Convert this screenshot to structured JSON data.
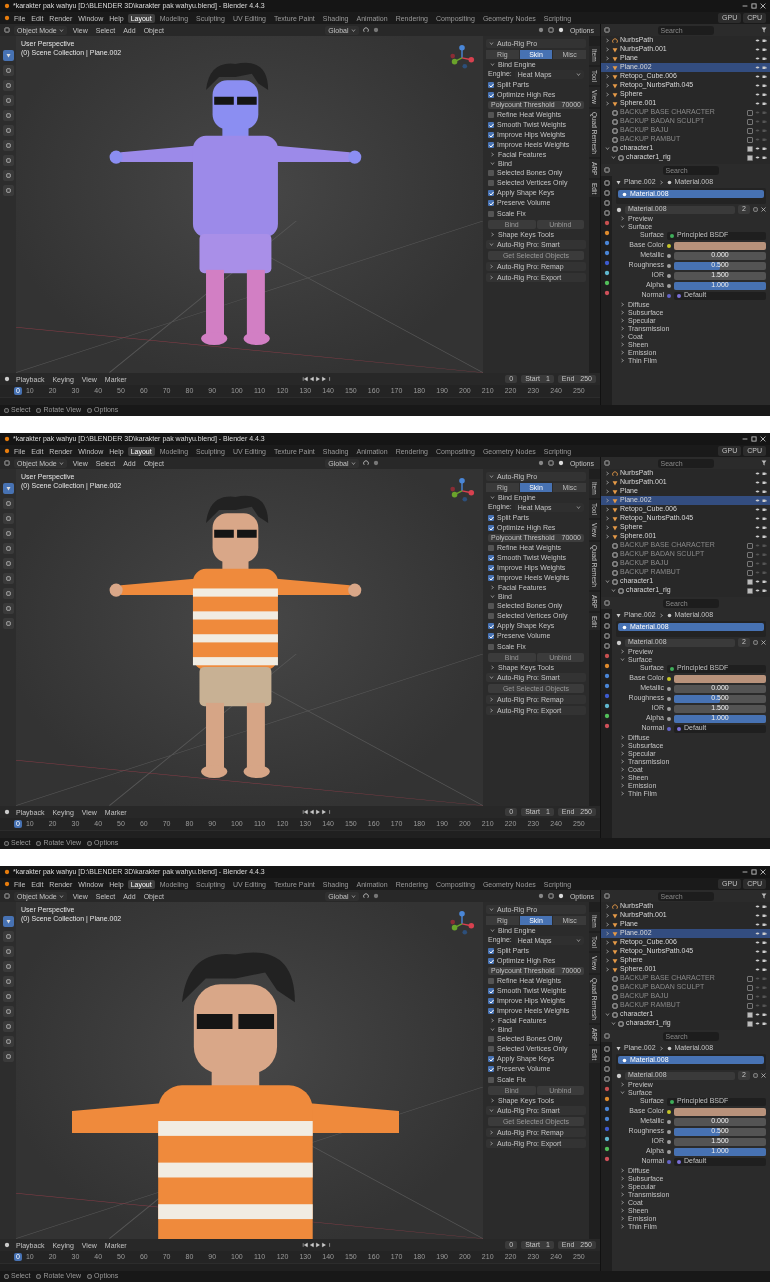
{
  "screens": [
    {
      "title": "*karakter pak wahyu [D:\\BLENDER 3D\\karakter pak wahyu.blend] - Blender 4.4.3",
      "menus": [
        "File",
        "Edit",
        "Render",
        "Window",
        "Help"
      ],
      "workspaces": [
        {
          "label": "Layout",
          "selected": true
        },
        {
          "label": "Modeling",
          "selected": false
        },
        {
          "label": "Sculpting",
          "selected": false
        },
        {
          "label": "UV Editing",
          "selected": false
        },
        {
          "label": "Texture Paint",
          "selected": false
        },
        {
          "label": "Shading",
          "selected": false
        },
        {
          "label": "Animation",
          "selected": false
        },
        {
          "label": "Rendering",
          "selected": false
        },
        {
          "label": "Compositing",
          "selected": false
        },
        {
          "label": "Geometry Nodes",
          "selected": false
        },
        {
          "label": "Scripting",
          "selected": false
        }
      ],
      "stats": [
        "GPU",
        "CPU"
      ],
      "header": {
        "mode": "Object Mode",
        "menus": [
          "View",
          "Select",
          "Add",
          "Object"
        ],
        "orientation": "Global",
        "options": "Options"
      },
      "viewport": {
        "kind": "normals",
        "lines": [
          "User Perspective",
          "(0) Scene Collection | Plane.002"
        ]
      },
      "arp": {
        "title": "Auto-Rig Pro",
        "tabs": [
          {
            "label": "Rig",
            "selected": false
          },
          {
            "label": "Skin",
            "selected": true
          },
          {
            "label": "Misc",
            "selected": false
          }
        ],
        "items": [
          {
            "kind": "section",
            "label": "Bind Engine",
            "expanded": true
          },
          {
            "kind": "select",
            "label": "Engine:",
            "value": "Heat Maps"
          },
          {
            "kind": "check",
            "label": "Split Parts",
            "checked": true
          },
          {
            "kind": "check",
            "label": "Optimize High Res",
            "checked": true
          },
          {
            "kind": "number",
            "label": "Polycount Threshold",
            "value": "70000"
          },
          {
            "kind": "check",
            "label": "Refine Heat Weights",
            "checked": false
          },
          {
            "kind": "check",
            "label": "Smooth Twist Weights",
            "checked": true
          },
          {
            "kind": "check",
            "label": "Improve Hips Weights",
            "checked": true
          },
          {
            "kind": "check",
            "label": "Improve Heels Weights",
            "checked": true
          },
          {
            "kind": "section",
            "label": "Facial Features",
            "expanded": false
          },
          {
            "kind": "section",
            "label": "Bind",
            "expanded": true
          },
          {
            "kind": "check",
            "label": "Selected Bones Only",
            "checked": false
          },
          {
            "kind": "check",
            "label": "Selected Vertices Only",
            "checked": false
          },
          {
            "kind": "check",
            "label": "Apply Shape Keys",
            "checked": true
          },
          {
            "kind": "check",
            "label": "Preserve Volume",
            "checked": true
          },
          {
            "kind": "check",
            "label": "Scale Fix",
            "checked": false
          },
          {
            "kind": "buttons",
            "labels": [
              "Bind",
              "Unbind"
            ]
          },
          {
            "kind": "section",
            "label": "Shape Keys Tools",
            "expanded": false
          },
          {
            "kind": "panel",
            "label": "Auto-Rig Pro: Smart",
            "expanded": true
          },
          {
            "kind": "button",
            "label": "Get Selected Objects"
          },
          {
            "kind": "panel",
            "label": "Auto-Rig Pro: Remap",
            "expanded": false
          },
          {
            "kind": "panel",
            "label": "Auto-Rig Pro: Export",
            "expanded": false
          }
        ]
      },
      "side_tabs": [
        "Item",
        "Tool",
        "View",
        "Quad Remesh",
        "ARP",
        "Edit"
      ],
      "outliner": {
        "placeholder": "Search",
        "items": [
          {
            "kind": "curve",
            "label": "NurbsPath",
            "selected": false,
            "expanded": false
          },
          {
            "kind": "mesh",
            "label": "NurbsPath.001",
            "selected": false,
            "expanded": false
          },
          {
            "kind": "mesh",
            "label": "Plane",
            "selected": false,
            "expanded": false
          },
          {
            "kind": "mesh",
            "label": "Plane.002",
            "selected": true,
            "expanded": false
          },
          {
            "kind": "mesh",
            "label": "Retopo_Cube.006",
            "selected": false,
            "expanded": false
          },
          {
            "kind": "mesh",
            "label": "Retopo_NurbsPath.045",
            "selected": false,
            "expanded": false
          },
          {
            "kind": "mesh",
            "label": "Sphere",
            "selected": false,
            "expanded": false
          },
          {
            "kind": "mesh",
            "label": "Sphere.001",
            "selected": false,
            "expanded": false
          },
          {
            "kind": "collection",
            "label": "BACKUP BASE CHARACTER",
            "selected": false,
            "included": false
          },
          {
            "kind": "collection",
            "label": "BACKUP BADAN SCULPT",
            "selected": false,
            "included": false
          },
          {
            "kind": "collection",
            "label": "BACKUP BAJU",
            "selected": false,
            "included": false
          },
          {
            "kind": "collection",
            "label": "BACKUP RAMBUT",
            "selected": false,
            "included": false
          },
          {
            "kind": "collection",
            "label": "character1",
            "selected": false,
            "included": true,
            "expanded": true,
            "children": [
              {
                "kind": "collection",
                "label": "character1_rig",
                "selected": false,
                "included": true,
                "expanded": true
              }
            ]
          }
        ]
      },
      "properties": {
        "placeholder": "Search",
        "breadcrumb": [
          "Plane.002",
          "Material.008"
        ],
        "slot": "Material.008",
        "material": "Material.008",
        "users": "2",
        "sections": [
          {
            "label": "Preview",
            "expanded": false
          },
          {
            "label": "Surface",
            "expanded": true
          }
        ],
        "surface_label": "Surface",
        "surface": "Principled BSDF",
        "inputs": [
          {
            "kind": "color",
            "label": "Base Color",
            "color": "#b8927b"
          },
          {
            "kind": "slider",
            "label": "Metallic",
            "value": "0.000",
            "level": 0
          },
          {
            "kind": "slider",
            "label": "Roughness",
            "value": "0.500",
            "level": 0.5
          },
          {
            "kind": "slider",
            "label": "IOR",
            "value": "1.500",
            "level": 0
          },
          {
            "kind": "slider",
            "label": "Alpha",
            "value": "1.000",
            "level": 1
          },
          {
            "kind": "link",
            "label": "Normal",
            "value": "Default"
          }
        ],
        "subsections": [
          {
            "label": "Diffuse",
            "expanded": false
          },
          {
            "label": "Subsurface",
            "expanded": false
          },
          {
            "label": "Specular",
            "expanded": false
          },
          {
            "label": "Transmission",
            "expanded": false
          },
          {
            "label": "Coat",
            "expanded": false
          },
          {
            "label": "Sheen",
            "expanded": false
          },
          {
            "label": "Emission",
            "expanded": false
          },
          {
            "label": "Thin Film",
            "expanded": false
          }
        ]
      },
      "timeline": {
        "menus": [
          "Playback",
          "Keying",
          "View",
          "Marker"
        ],
        "frame": "0",
        "start_label": "Start",
        "start": "1",
        "end_label": "End",
        "end": "250",
        "playhead": "0",
        "ticks": [
          "10",
          "20",
          "30",
          "40",
          "50",
          "60",
          "70",
          "80",
          "90",
          "100",
          "110",
          "120",
          "130",
          "140",
          "150",
          "160",
          "170",
          "180",
          "190",
          "200",
          "210",
          "220",
          "230",
          "240",
          "250"
        ]
      },
      "status": [
        "Select",
        "Rotate View",
        "Options"
      ]
    },
    {
      "title": "*karakter pak wahyu [D:\\BLENDER 3D\\karakter pak wahyu.blend] - Blender 4.4.3",
      "menus": [
        "File",
        "Edit",
        "Render",
        "Window",
        "Help"
      ],
      "workspaces": [
        {
          "label": "Layout",
          "selected": true
        },
        {
          "label": "Modeling",
          "selected": false
        },
        {
          "label": "Sculpting",
          "selected": false
        },
        {
          "label": "UV Editing",
          "selected": false
        },
        {
          "label": "Texture Paint",
          "selected": false
        },
        {
          "label": "Shading",
          "selected": false
        },
        {
          "label": "Animation",
          "selected": false
        },
        {
          "label": "Rendering",
          "selected": false
        },
        {
          "label": "Compositing",
          "selected": false
        },
        {
          "label": "Geometry Nodes",
          "selected": false
        },
        {
          "label": "Scripting",
          "selected": false
        }
      ],
      "stats": [
        "GPU",
        "CPU"
      ],
      "header": {
        "mode": "Object Mode",
        "menus": [
          "View",
          "Select",
          "Add",
          "Object"
        ],
        "orientation": "Global",
        "options": "Options"
      },
      "viewport": {
        "kind": "textured",
        "lines": [
          "User Perspective",
          "(0) Scene Collection | Plane.002"
        ]
      },
      "arp": {
        "title": "Auto-Rig Pro",
        "tabs": [
          {
            "label": "Rig",
            "selected": false
          },
          {
            "label": "Skin",
            "selected": true
          },
          {
            "label": "Misc",
            "selected": false
          }
        ],
        "items": [
          {
            "kind": "section",
            "label": "Bind Engine",
            "expanded": true
          },
          {
            "kind": "select",
            "label": "Engine:",
            "value": "Heat Maps"
          },
          {
            "kind": "check",
            "label": "Split Parts",
            "checked": true
          },
          {
            "kind": "check",
            "label": "Optimize High Res",
            "checked": true
          },
          {
            "kind": "number",
            "label": "Polycount Threshold",
            "value": "70000"
          },
          {
            "kind": "check",
            "label": "Refine Heat Weights",
            "checked": false
          },
          {
            "kind": "check",
            "label": "Smooth Twist Weights",
            "checked": true
          },
          {
            "kind": "check",
            "label": "Improve Hips Weights",
            "checked": true
          },
          {
            "kind": "check",
            "label": "Improve Heels Weights",
            "checked": true
          },
          {
            "kind": "section",
            "label": "Facial Features",
            "expanded": false
          },
          {
            "kind": "section",
            "label": "Bind",
            "expanded": true
          },
          {
            "kind": "check",
            "label": "Selected Bones Only",
            "checked": false
          },
          {
            "kind": "check",
            "label": "Selected Vertices Only",
            "checked": false
          },
          {
            "kind": "check",
            "label": "Apply Shape Keys",
            "checked": true
          },
          {
            "kind": "check",
            "label": "Preserve Volume",
            "checked": true
          },
          {
            "kind": "check",
            "label": "Scale Fix",
            "checked": false
          },
          {
            "kind": "buttons",
            "labels": [
              "Bind",
              "Unbind"
            ]
          },
          {
            "kind": "section",
            "label": "Shape Keys Tools",
            "expanded": false
          },
          {
            "kind": "panel",
            "label": "Auto-Rig Pro: Smart",
            "expanded": true
          },
          {
            "kind": "button",
            "label": "Get Selected Objects"
          },
          {
            "kind": "panel",
            "label": "Auto-Rig Pro: Remap",
            "expanded": false
          },
          {
            "kind": "panel",
            "label": "Auto-Rig Pro: Export",
            "expanded": false
          }
        ]
      },
      "side_tabs": [
        "Item",
        "Tool",
        "View",
        "Quad Remesh",
        "ARP",
        "Edit"
      ],
      "outliner": {
        "placeholder": "Search",
        "items": [
          {
            "kind": "curve",
            "label": "NurbsPath",
            "selected": false,
            "expanded": false
          },
          {
            "kind": "mesh",
            "label": "NurbsPath.001",
            "selected": false,
            "expanded": false
          },
          {
            "kind": "mesh",
            "label": "Plane",
            "selected": false,
            "expanded": false
          },
          {
            "kind": "mesh",
            "label": "Plane.002",
            "selected": true,
            "expanded": false
          },
          {
            "kind": "mesh",
            "label": "Retopo_Cube.006",
            "selected": false,
            "expanded": false
          },
          {
            "kind": "mesh",
            "label": "Retopo_NurbsPath.045",
            "selected": false,
            "expanded": false
          },
          {
            "kind": "mesh",
            "label": "Sphere",
            "selected": false,
            "expanded": false
          },
          {
            "kind": "mesh",
            "label": "Sphere.001",
            "selected": false,
            "expanded": false
          },
          {
            "kind": "collection",
            "label": "BACKUP BASE CHARACTER",
            "selected": false,
            "included": false
          },
          {
            "kind": "collection",
            "label": "BACKUP BADAN SCULPT",
            "selected": false,
            "included": false
          },
          {
            "kind": "collection",
            "label": "BACKUP BAJU",
            "selected": false,
            "included": false
          },
          {
            "kind": "collection",
            "label": "BACKUP RAMBUT",
            "selected": false,
            "included": false
          },
          {
            "kind": "collection",
            "label": "character1",
            "selected": false,
            "included": true,
            "expanded": true,
            "children": [
              {
                "kind": "collection",
                "label": "character1_rig",
                "selected": false,
                "included": true,
                "expanded": true
              }
            ]
          }
        ]
      },
      "properties": {
        "placeholder": "Search",
        "breadcrumb": [
          "Plane.002",
          "Material.008"
        ],
        "slot": "Material.008",
        "material": "Material.008",
        "users": "2",
        "sections": [
          {
            "label": "Preview",
            "expanded": false
          },
          {
            "label": "Surface",
            "expanded": true
          }
        ],
        "surface_label": "Surface",
        "surface": "Principled BSDF",
        "inputs": [
          {
            "kind": "color",
            "label": "Base Color",
            "color": "#b8927b"
          },
          {
            "kind": "slider",
            "label": "Metallic",
            "value": "0.000",
            "level": 0
          },
          {
            "kind": "slider",
            "label": "Roughness",
            "value": "0.500",
            "level": 0.5
          },
          {
            "kind": "slider",
            "label": "IOR",
            "value": "1.500",
            "level": 0
          },
          {
            "kind": "slider",
            "label": "Alpha",
            "value": "1.000",
            "level": 1
          },
          {
            "kind": "link",
            "label": "Normal",
            "value": "Default"
          }
        ],
        "subsections": [
          {
            "label": "Diffuse",
            "expanded": false
          },
          {
            "label": "Subsurface",
            "expanded": false
          },
          {
            "label": "Specular",
            "expanded": false
          },
          {
            "label": "Transmission",
            "expanded": false
          },
          {
            "label": "Coat",
            "expanded": false
          },
          {
            "label": "Sheen",
            "expanded": false
          },
          {
            "label": "Emission",
            "expanded": false
          },
          {
            "label": "Thin Film",
            "expanded": false
          }
        ]
      },
      "timeline": {
        "menus": [
          "Playback",
          "Keying",
          "View",
          "Marker"
        ],
        "frame": "0",
        "start_label": "Start",
        "start": "1",
        "end_label": "End",
        "end": "250",
        "playhead": "0",
        "ticks": [
          "10",
          "20",
          "30",
          "40",
          "50",
          "60",
          "70",
          "80",
          "90",
          "100",
          "110",
          "120",
          "130",
          "140",
          "150",
          "160",
          "170",
          "180",
          "190",
          "200",
          "210",
          "220",
          "230",
          "240",
          "250"
        ]
      },
      "status": [
        "Select",
        "Rotate View",
        "Options"
      ]
    },
    {
      "title": "*karakter pak wahyu [D:\\BLENDER 3D\\karakter pak wahyu.blend] - Blender 4.4.3",
      "menus": [
        "File",
        "Edit",
        "Render",
        "Window",
        "Help"
      ],
      "workspaces": [
        {
          "label": "Layout",
          "selected": true
        },
        {
          "label": "Modeling",
          "selected": false
        },
        {
          "label": "Sculpting",
          "selected": false
        },
        {
          "label": "UV Editing",
          "selected": false
        },
        {
          "label": "Texture Paint",
          "selected": false
        },
        {
          "label": "Shading",
          "selected": false
        },
        {
          "label": "Animation",
          "selected": false
        },
        {
          "label": "Rendering",
          "selected": false
        },
        {
          "label": "Compositing",
          "selected": false
        },
        {
          "label": "Geometry Nodes",
          "selected": false
        },
        {
          "label": "Scripting",
          "selected": false
        }
      ],
      "stats": [
        "GPU",
        "CPU"
      ],
      "header": {
        "mode": "Object Mode",
        "menus": [
          "View",
          "Select",
          "Add",
          "Object"
        ],
        "orientation": "Global",
        "options": "Options"
      },
      "viewport": {
        "kind": "closeup",
        "lines": [
          "User Perspective",
          "(0) Scene Collection | Plane.002"
        ]
      },
      "arp": {
        "title": "Auto-Rig Pro",
        "tabs": [
          {
            "label": "Rig",
            "selected": false
          },
          {
            "label": "Skin",
            "selected": true
          },
          {
            "label": "Misc",
            "selected": false
          }
        ],
        "items": [
          {
            "kind": "section",
            "label": "Bind Engine",
            "expanded": true
          },
          {
            "kind": "select",
            "label": "Engine:",
            "value": "Heat Maps"
          },
          {
            "kind": "check",
            "label": "Split Parts",
            "checked": true
          },
          {
            "kind": "check",
            "label": "Optimize High Res",
            "checked": true
          },
          {
            "kind": "number",
            "label": "Polycount Threshold",
            "value": "70000"
          },
          {
            "kind": "check",
            "label": "Refine Heat Weights",
            "checked": false
          },
          {
            "kind": "check",
            "label": "Smooth Twist Weights",
            "checked": true
          },
          {
            "kind": "check",
            "label": "Improve Hips Weights",
            "checked": true
          },
          {
            "kind": "check",
            "label": "Improve Heels Weights",
            "checked": true
          },
          {
            "kind": "section",
            "label": "Facial Features",
            "expanded": false
          },
          {
            "kind": "section",
            "label": "Bind",
            "expanded": true
          },
          {
            "kind": "check",
            "label": "Selected Bones Only",
            "checked": false
          },
          {
            "kind": "check",
            "label": "Selected Vertices Only",
            "checked": false
          },
          {
            "kind": "check",
            "label": "Apply Shape Keys",
            "checked": true
          },
          {
            "kind": "check",
            "label": "Preserve Volume",
            "checked": true
          },
          {
            "kind": "check",
            "label": "Scale Fix",
            "checked": false
          },
          {
            "kind": "buttons",
            "labels": [
              "Bind",
              "Unbind"
            ]
          },
          {
            "kind": "section",
            "label": "Shape Keys Tools",
            "expanded": false
          },
          {
            "kind": "panel",
            "label": "Auto-Rig Pro: Smart",
            "expanded": true
          },
          {
            "kind": "button",
            "label": "Get Selected Objects"
          },
          {
            "kind": "panel",
            "label": "Auto-Rig Pro: Remap",
            "expanded": false
          },
          {
            "kind": "panel",
            "label": "Auto-Rig Pro: Export",
            "expanded": false
          }
        ]
      },
      "side_tabs": [
        "Item",
        "Tool",
        "View",
        "Quad Remesh",
        "ARP",
        "Edit"
      ],
      "outliner": {
        "placeholder": "Search",
        "items": [
          {
            "kind": "curve",
            "label": "NurbsPath",
            "selected": false,
            "expanded": false
          },
          {
            "kind": "mesh",
            "label": "NurbsPath.001",
            "selected": false,
            "expanded": false
          },
          {
            "kind": "mesh",
            "label": "Plane",
            "selected": false,
            "expanded": false
          },
          {
            "kind": "mesh",
            "label": "Plane.002",
            "selected": true,
            "expanded": false
          },
          {
            "kind": "mesh",
            "label": "Retopo_Cube.006",
            "selected": false,
            "expanded": false
          },
          {
            "kind": "mesh",
            "label": "Retopo_NurbsPath.045",
            "selected": false,
            "expanded": false
          },
          {
            "kind": "mesh",
            "label": "Sphere",
            "selected": false,
            "expanded": false
          },
          {
            "kind": "mesh",
            "label": "Sphere.001",
            "selected": false,
            "expanded": false
          },
          {
            "kind": "collection",
            "label": "BACKUP BASE CHARACTER",
            "selected": false,
            "included": false
          },
          {
            "kind": "collection",
            "label": "BACKUP BADAN SCULPT",
            "selected": false,
            "included": false
          },
          {
            "kind": "collection",
            "label": "BACKUP BAJU",
            "selected": false,
            "included": false
          },
          {
            "kind": "collection",
            "label": "BACKUP RAMBUT",
            "selected": false,
            "included": false
          },
          {
            "kind": "collection",
            "label": "character1",
            "selected": false,
            "included": true,
            "expanded": true,
            "children": [
              {
                "kind": "collection",
                "label": "character1_rig",
                "selected": false,
                "included": true,
                "expanded": true
              }
            ]
          }
        ]
      },
      "properties": {
        "placeholder": "Search",
        "breadcrumb": [
          "Plane.002",
          "Material.008"
        ],
        "slot": "Material.008",
        "material": "Material.008",
        "users": "2",
        "sections": [
          {
            "label": "Preview",
            "expanded": false
          },
          {
            "label": "Surface",
            "expanded": true
          }
        ],
        "surface_label": "Surface",
        "surface": "Principled BSDF",
        "inputs": [
          {
            "kind": "color",
            "label": "Base Color",
            "color": "#b8927b"
          },
          {
            "kind": "slider",
            "label": "Metallic",
            "value": "0.000",
            "level": 0
          },
          {
            "kind": "slider",
            "label": "Roughness",
            "value": "0.500",
            "level": 0.5
          },
          {
            "kind": "slider",
            "label": "IOR",
            "value": "1.500",
            "level": 0
          },
          {
            "kind": "slider",
            "label": "Alpha",
            "value": "1.000",
            "level": 1
          },
          {
            "kind": "link",
            "label": "Normal",
            "value": "Default"
          }
        ],
        "subsections": [
          {
            "label": "Diffuse",
            "expanded": false
          },
          {
            "label": "Subsurface",
            "expanded": false
          },
          {
            "label": "Specular",
            "expanded": false
          },
          {
            "label": "Transmission",
            "expanded": false
          },
          {
            "label": "Coat",
            "expanded": false
          },
          {
            "label": "Sheen",
            "expanded": false
          },
          {
            "label": "Emission",
            "expanded": false
          },
          {
            "label": "Thin Film",
            "expanded": false
          }
        ]
      },
      "timeline": {
        "menus": [
          "Playback",
          "Keying",
          "View",
          "Marker"
        ],
        "frame": "0",
        "start_label": "Start",
        "start": "1",
        "end_label": "End",
        "end": "250",
        "playhead": "0",
        "ticks": [
          "10",
          "20",
          "30",
          "40",
          "50",
          "60",
          "70",
          "80",
          "90",
          "100",
          "110",
          "120",
          "130",
          "140",
          "150",
          "160",
          "170",
          "180",
          "190",
          "200",
          "210",
          "220",
          "230",
          "240",
          "250"
        ]
      },
      "status": [
        "Select",
        "Rotate View",
        "Options"
      ]
    }
  ]
}
